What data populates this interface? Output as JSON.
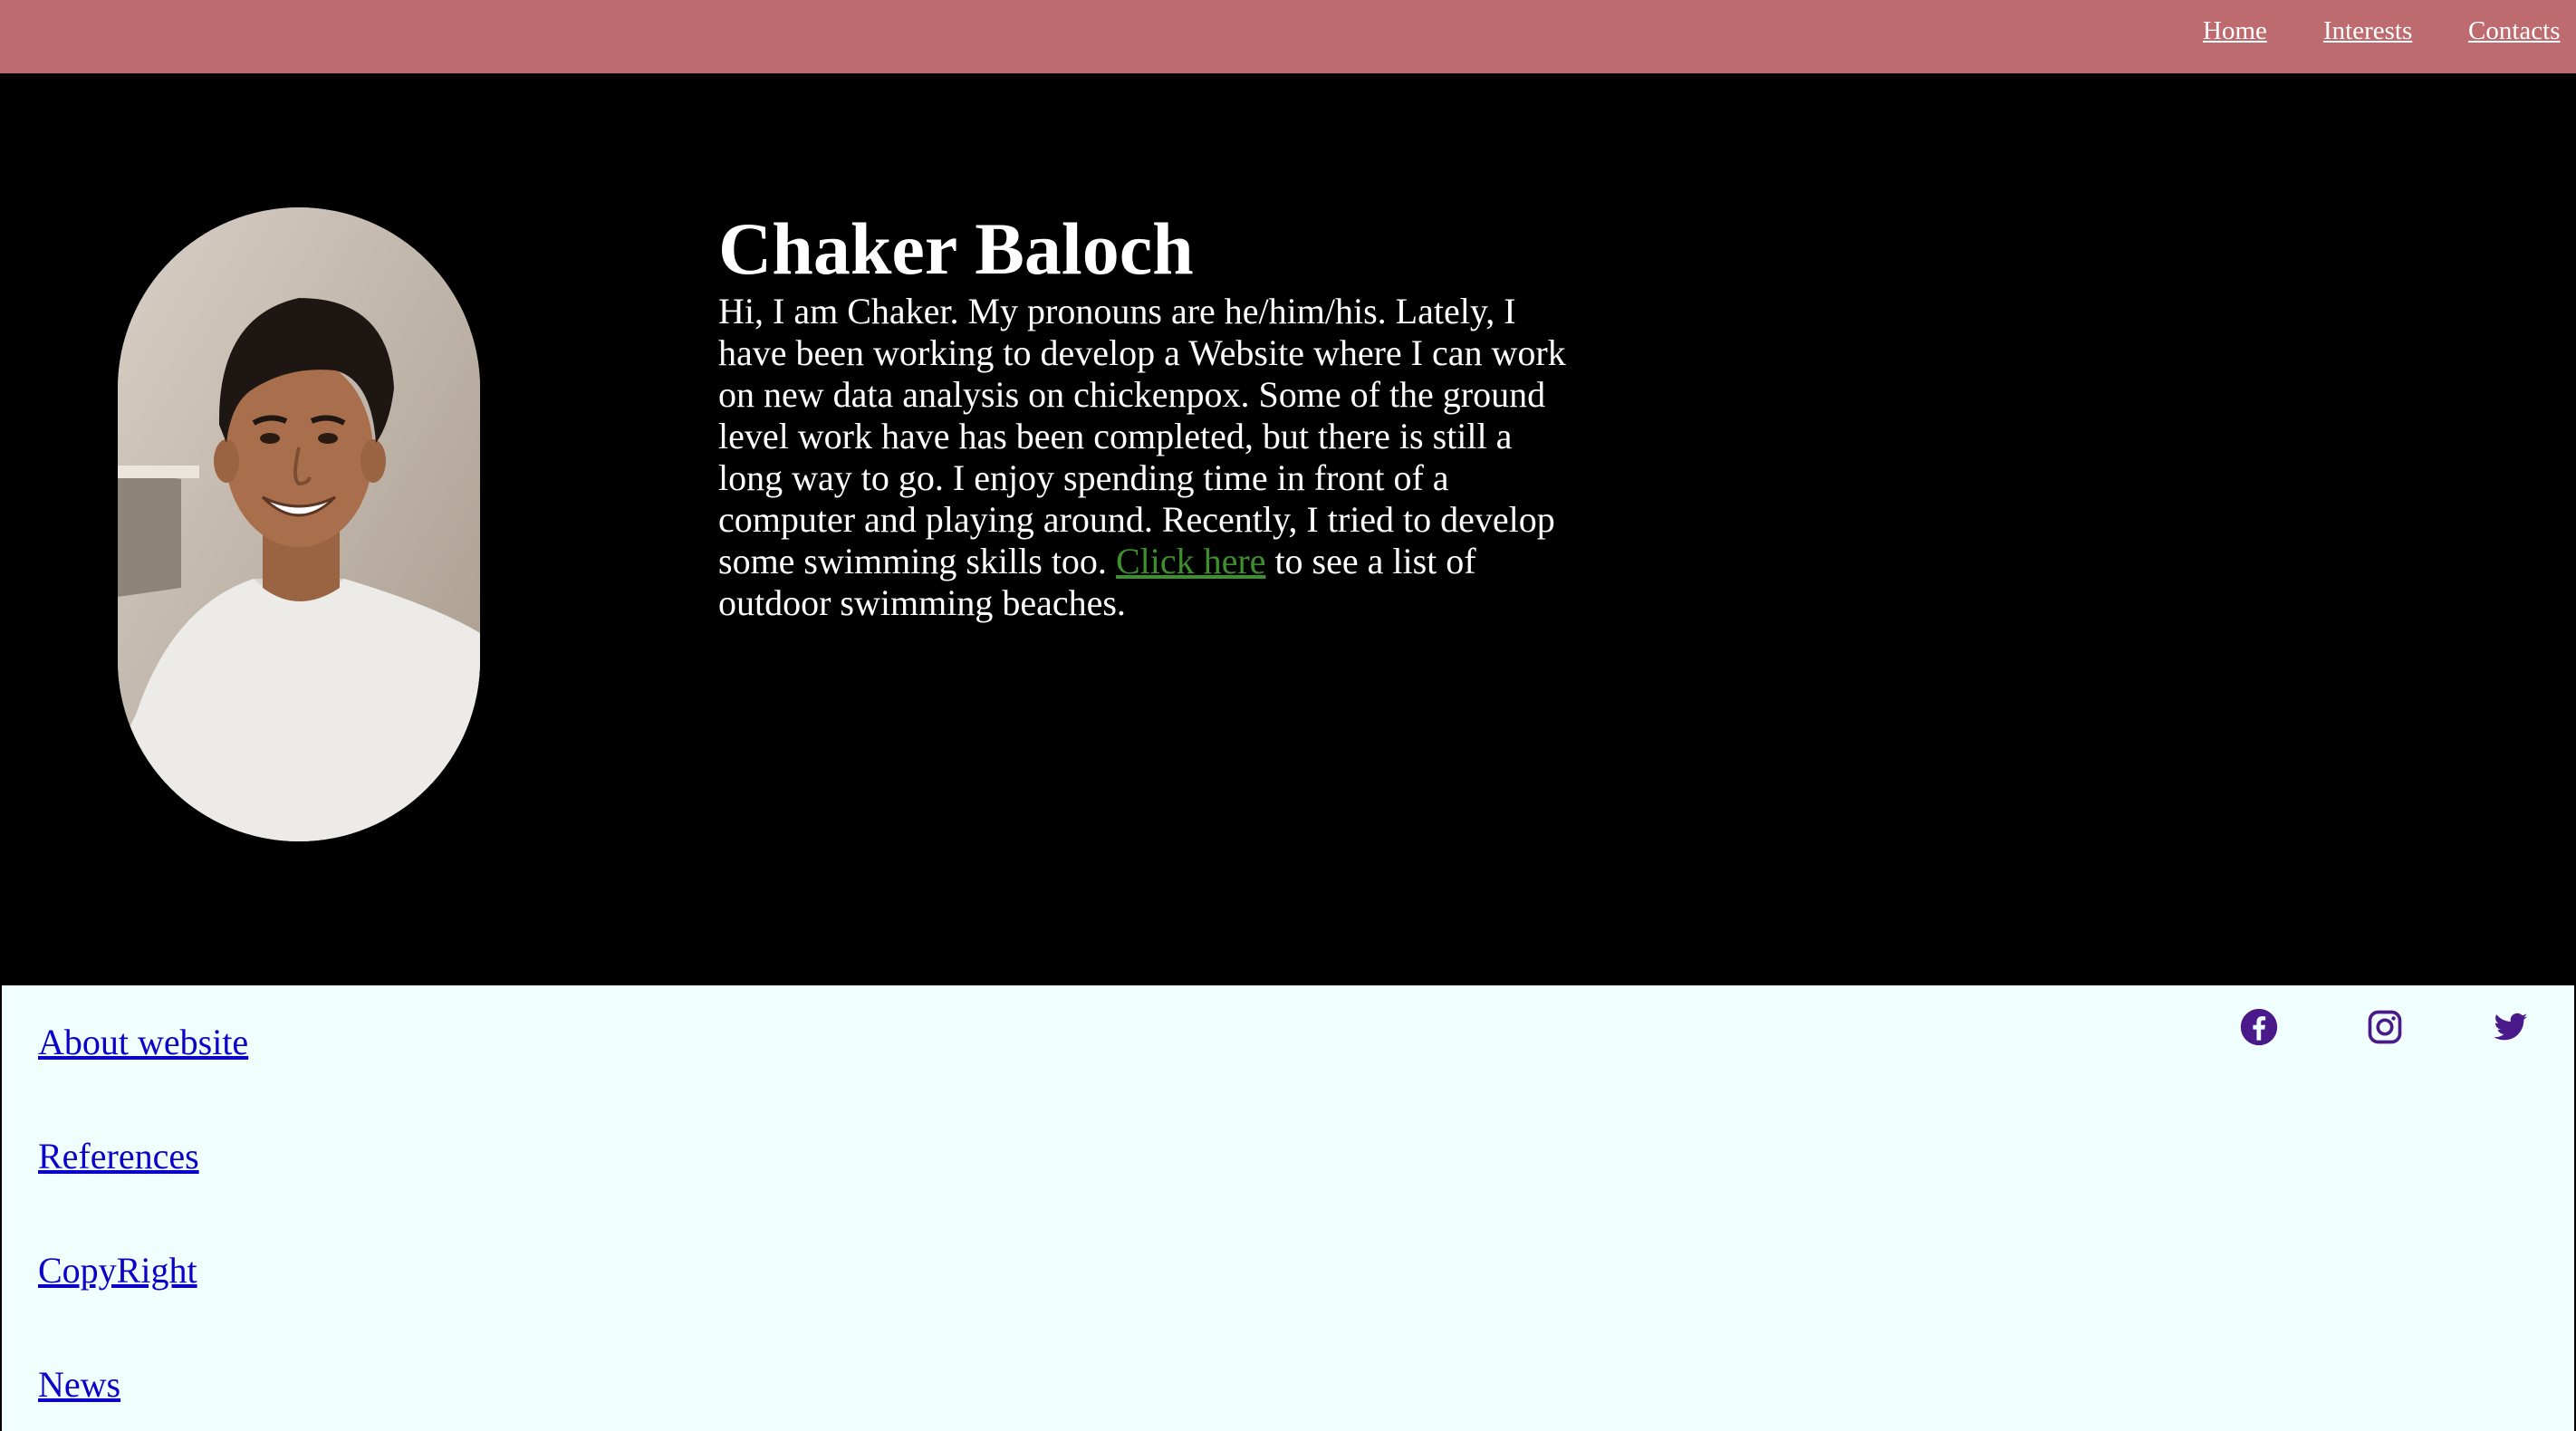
{
  "nav": {
    "home": "Home",
    "interests": "Interests",
    "contacts": "Contacts"
  },
  "profile": {
    "name": "Chaker Baloch",
    "bio_before_link": "Hi, I am Chaker. My pronouns are he/him/his. Lately, I have been working to develop a Website where I can work on new data analysis on chickenpox. Some of the ground level work have has been completed, but there is still a long way to go. I enjoy spending time in front of a computer and playing around. Recently, I tried to develop some swimming skills too. ",
    "link_text": "Click here",
    "bio_after_link": " to see a list of outdoor swimming beaches.",
    "photo": "portrait-photo"
  },
  "footer": {
    "links": [
      "About website",
      "References",
      "CopyRight",
      "News"
    ],
    "social_icons": [
      "facebook-icon",
      "instagram-icon",
      "twitter-icon"
    ]
  },
  "colors": {
    "topbar": "#bd6b6e",
    "hero_bg": "#000000",
    "footer_bg": "#f0fffd",
    "link_green": "#3e8f2e",
    "footer_link": "#0b00c9",
    "social_icon": "#4a1a8a"
  }
}
